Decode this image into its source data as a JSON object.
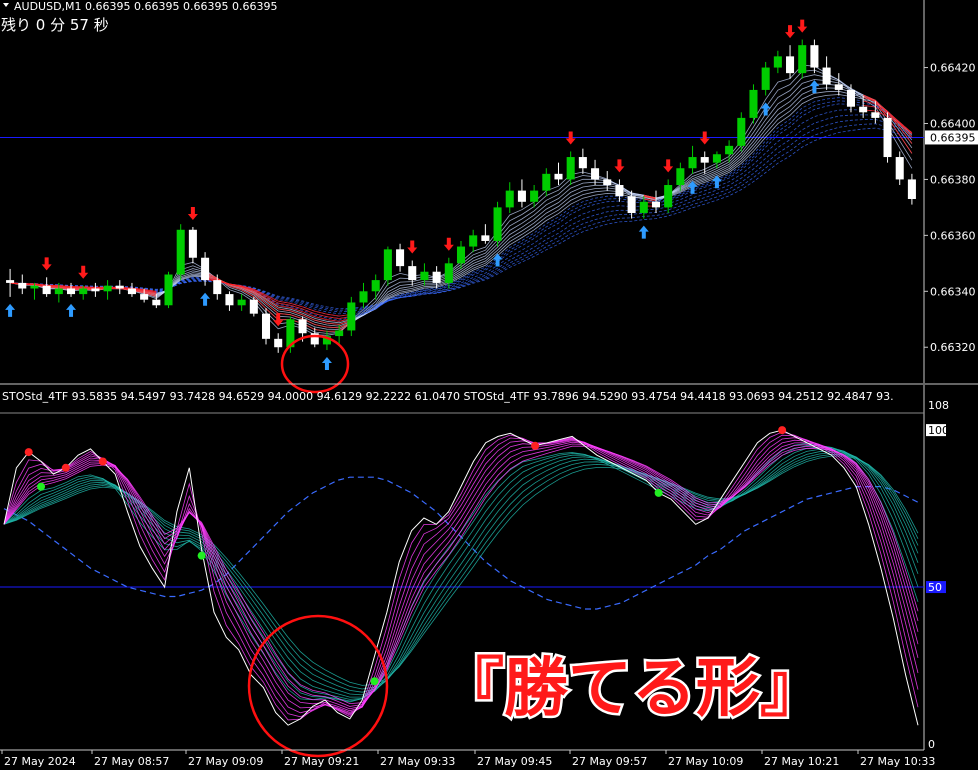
{
  "header": {
    "symbol_line": "AUDUSD,M1  0.66395 0.66395 0.66395 0.66395",
    "timer_line": "残り 0 分 57 秒"
  },
  "indicator": {
    "label": "STOStd_4TF 93.5835 94.5497 93.7428 94.6529 94.0000 94.6129 92.2222 61.0470  STOStd_4TF 93.7896 94.5290 93.4754 94.4418 93.0693 94.2512 92.4847 93."
  },
  "banner": {
    "text": "『勝てる形』"
  },
  "colors": {
    "background": "#000000",
    "bull": "#00cc00",
    "bear": "#ffffff",
    "grid_line": "#1a1aff",
    "ribbon_red": "#ff2020",
    "ribbon_blue": "#3a6bff",
    "arrow_up": "#2e9bff",
    "arrow_down": "#ff1a1a",
    "stoch_magenta": "#ff40ff",
    "stoch_teal": "#1fb5a8",
    "circle": "#ff1010",
    "dot_green": "#22ee22",
    "dot_red": "#ff2222"
  },
  "chart_data": [
    {
      "type": "candlestick",
      "title": "AUDUSD,M1",
      "y_ticks": [
        "0.66420",
        "0.66400",
        "0.66380",
        "0.66360",
        "0.66340",
        "0.66320"
      ],
      "y_tick_values": [
        0.6642,
        0.664,
        0.6638,
        0.6636,
        0.6634,
        0.6632
      ],
      "ylim": [
        0.66309,
        0.66437
      ],
      "current_price": "0.66395",
      "current_price_value": 0.66395,
      "candles": [
        [
          0.66344,
          0.66348,
          0.66338,
          0.66343
        ],
        [
          0.66343,
          0.66346,
          0.66339,
          0.66341
        ],
        [
          0.66341,
          0.66343,
          0.66337,
          0.66342
        ],
        [
          0.66342,
          0.66345,
          0.66338,
          0.66339
        ],
        [
          0.66339,
          0.66343,
          0.66336,
          0.66341
        ],
        [
          0.66341,
          0.66343,
          0.66338,
          0.66339
        ],
        [
          0.66339,
          0.66342,
          0.66337,
          0.66341
        ],
        [
          0.66341,
          0.66343,
          0.66338,
          0.6634
        ],
        [
          0.6634,
          0.66344,
          0.66337,
          0.66342
        ],
        [
          0.66342,
          0.66344,
          0.66339,
          0.66341
        ],
        [
          0.66341,
          0.66343,
          0.66338,
          0.66339
        ],
        [
          0.66339,
          0.66341,
          0.66336,
          0.66337
        ],
        [
          0.66337,
          0.66339,
          0.66334,
          0.66335
        ],
        [
          0.66335,
          0.66347,
          0.66334,
          0.66346
        ],
        [
          0.66346,
          0.66364,
          0.66344,
          0.66362
        ],
        [
          0.66362,
          0.66363,
          0.6635,
          0.66352
        ],
        [
          0.66352,
          0.66354,
          0.66342,
          0.66344
        ],
        [
          0.66344,
          0.66346,
          0.66337,
          0.66339
        ],
        [
          0.66339,
          0.6634,
          0.66333,
          0.66335
        ],
        [
          0.66335,
          0.66339,
          0.66333,
          0.66337
        ],
        [
          0.66337,
          0.66338,
          0.66331,
          0.66332
        ],
        [
          0.66332,
          0.66334,
          0.66321,
          0.66323
        ],
        [
          0.66323,
          0.66325,
          0.66318,
          0.6632
        ],
        [
          0.6632,
          0.66331,
          0.66318,
          0.6633
        ],
        [
          0.6633,
          0.66331,
          0.66322,
          0.66325
        ],
        [
          0.66325,
          0.66327,
          0.6632,
          0.66321
        ],
        [
          0.66321,
          0.66326,
          0.66319,
          0.66324
        ],
        [
          0.66324,
          0.66328,
          0.66321,
          0.66326
        ],
        [
          0.66326,
          0.66338,
          0.66324,
          0.66336
        ],
        [
          0.66336,
          0.66343,
          0.66334,
          0.6634
        ],
        [
          0.6634,
          0.66346,
          0.66337,
          0.66344
        ],
        [
          0.66344,
          0.66356,
          0.66342,
          0.66355
        ],
        [
          0.66355,
          0.66357,
          0.66347,
          0.66349
        ],
        [
          0.66349,
          0.66351,
          0.66342,
          0.66344
        ],
        [
          0.66344,
          0.6635,
          0.66342,
          0.66347
        ],
        [
          0.66347,
          0.66349,
          0.66341,
          0.66343
        ],
        [
          0.66343,
          0.66352,
          0.66341,
          0.6635
        ],
        [
          0.6635,
          0.66358,
          0.66348,
          0.66356
        ],
        [
          0.66356,
          0.66362,
          0.66354,
          0.6636
        ],
        [
          0.6636,
          0.66364,
          0.66357,
          0.66358
        ],
        [
          0.66358,
          0.66372,
          0.66356,
          0.6637
        ],
        [
          0.6637,
          0.66379,
          0.66368,
          0.66376
        ],
        [
          0.66376,
          0.6638,
          0.6637,
          0.66372
        ],
        [
          0.66372,
          0.66378,
          0.6637,
          0.66376
        ],
        [
          0.66376,
          0.66384,
          0.66374,
          0.66382
        ],
        [
          0.66382,
          0.66386,
          0.66378,
          0.6638
        ],
        [
          0.6638,
          0.6639,
          0.66378,
          0.66388
        ],
        [
          0.66388,
          0.66391,
          0.66382,
          0.66384
        ],
        [
          0.66384,
          0.66387,
          0.66378,
          0.6638
        ],
        [
          0.6638,
          0.66383,
          0.66376,
          0.66378
        ],
        [
          0.66378,
          0.6638,
          0.66372,
          0.66374
        ],
        [
          0.66374,
          0.66376,
          0.66366,
          0.66368
        ],
        [
          0.66368,
          0.66374,
          0.66366,
          0.66372
        ],
        [
          0.66372,
          0.66376,
          0.66368,
          0.6637
        ],
        [
          0.6637,
          0.6638,
          0.66368,
          0.66378
        ],
        [
          0.66378,
          0.66386,
          0.66376,
          0.66384
        ],
        [
          0.66384,
          0.66392,
          0.66382,
          0.66388
        ],
        [
          0.66388,
          0.6639,
          0.66382,
          0.66386
        ],
        [
          0.66386,
          0.6639,
          0.66384,
          0.66389
        ],
        [
          0.66389,
          0.66394,
          0.66386,
          0.66392
        ],
        [
          0.66392,
          0.66404,
          0.6639,
          0.66402
        ],
        [
          0.66402,
          0.66414,
          0.664,
          0.66412
        ],
        [
          0.66412,
          0.66422,
          0.6641,
          0.6642
        ],
        [
          0.6642,
          0.66426,
          0.66418,
          0.66424
        ],
        [
          0.66424,
          0.66428,
          0.66416,
          0.66418
        ],
        [
          0.66418,
          0.6643,
          0.66416,
          0.66428
        ],
        [
          0.66428,
          0.6643,
          0.66418,
          0.6642
        ],
        [
          0.6642,
          0.66424,
          0.66412,
          0.66414
        ],
        [
          0.66414,
          0.66418,
          0.6641,
          0.66412
        ],
        [
          0.66412,
          0.66414,
          0.66404,
          0.66406
        ],
        [
          0.66406,
          0.6641,
          0.66402,
          0.66404
        ],
        [
          0.66404,
          0.66408,
          0.664,
          0.66402
        ],
        [
          0.66402,
          0.66404,
          0.66386,
          0.66388
        ],
        [
          0.66388,
          0.6639,
          0.66378,
          0.6638
        ],
        [
          0.6638,
          0.66382,
          0.66371,
          0.66373
        ]
      ],
      "up_arrow_bars": [
        0,
        5,
        16,
        26,
        40,
        52,
        56,
        58,
        62,
        66
      ],
      "down_arrow_bars": [
        3,
        6,
        15,
        22,
        33,
        36,
        46,
        50,
        54,
        57,
        64,
        65
      ],
      "x_ticks": [
        "27 May 2024",
        "27 May 08:57",
        "27 May 09:09",
        "27 May 09:21",
        "27 May 09:33",
        "27 May 09:45",
        "27 May 09:57",
        "27 May 10:09",
        "27 May 10:21",
        "27 May 10:33"
      ]
    },
    {
      "type": "line",
      "title": "STOStd_4TF",
      "ylim": [
        0,
        108
      ],
      "y_ticks": [
        "108",
        "100",
        "50",
        "0"
      ],
      "y_tick_values": [
        108,
        100,
        50,
        0
      ],
      "level_line": 50,
      "fast_series": [
        70,
        88,
        93,
        90,
        86,
        88,
        92,
        94,
        90,
        86,
        74,
        63,
        56,
        50,
        74,
        88,
        62,
        42,
        34,
        30,
        22,
        18,
        10,
        6,
        8,
        12,
        14,
        10,
        8,
        14,
        28,
        42,
        58,
        68,
        72,
        70,
        74,
        82,
        90,
        96,
        98,
        99,
        97,
        95,
        96,
        97,
        98,
        95,
        92,
        90,
        88,
        86,
        84,
        80,
        78,
        74,
        70,
        72,
        78,
        84,
        90,
        96,
        99,
        100,
        98,
        96,
        94,
        92,
        88,
        82,
        70,
        56,
        40,
        22,
        6
      ],
      "slow_series": [
        70,
        76,
        80,
        82,
        82,
        84,
        86,
        86,
        84,
        80,
        74,
        68,
        64,
        60,
        62,
        66,
        60,
        52,
        44,
        38,
        32,
        26,
        20,
        15,
        13,
        14,
        15,
        14,
        13,
        15,
        20,
        28,
        38,
        48,
        55,
        60,
        65,
        70,
        76,
        82,
        86,
        89,
        91,
        91,
        92,
        93,
        93,
        92,
        90,
        88,
        86,
        84,
        82,
        80,
        78,
        76,
        74,
        74,
        76,
        80,
        84,
        88,
        92,
        95,
        96,
        96,
        95,
        94,
        92,
        88,
        82,
        74,
        64,
        52,
        40
      ],
      "baseline_series": [
        75,
        73,
        71,
        68,
        65,
        62,
        59,
        56,
        54,
        52,
        50,
        49,
        48,
        47,
        47,
        48,
        49,
        51,
        54,
        58,
        62,
        66,
        70,
        74,
        77,
        80,
        82,
        84,
        85,
        85,
        85,
        84,
        82,
        80,
        77,
        74,
        70,
        66,
        62,
        58,
        55,
        52,
        50,
        48,
        46,
        45,
        44,
        43,
        43,
        44,
        45,
        47,
        49,
        51,
        53,
        55,
        57,
        60,
        62,
        65,
        68,
        70,
        72,
        74,
        76,
        78,
        79,
        80,
        81,
        82,
        82,
        82,
        81,
        79,
        77
      ],
      "green_dot_bars": [
        3,
        16,
        30,
        53
      ],
      "red_dot_bars": [
        2,
        5,
        8,
        43,
        63
      ]
    }
  ]
}
